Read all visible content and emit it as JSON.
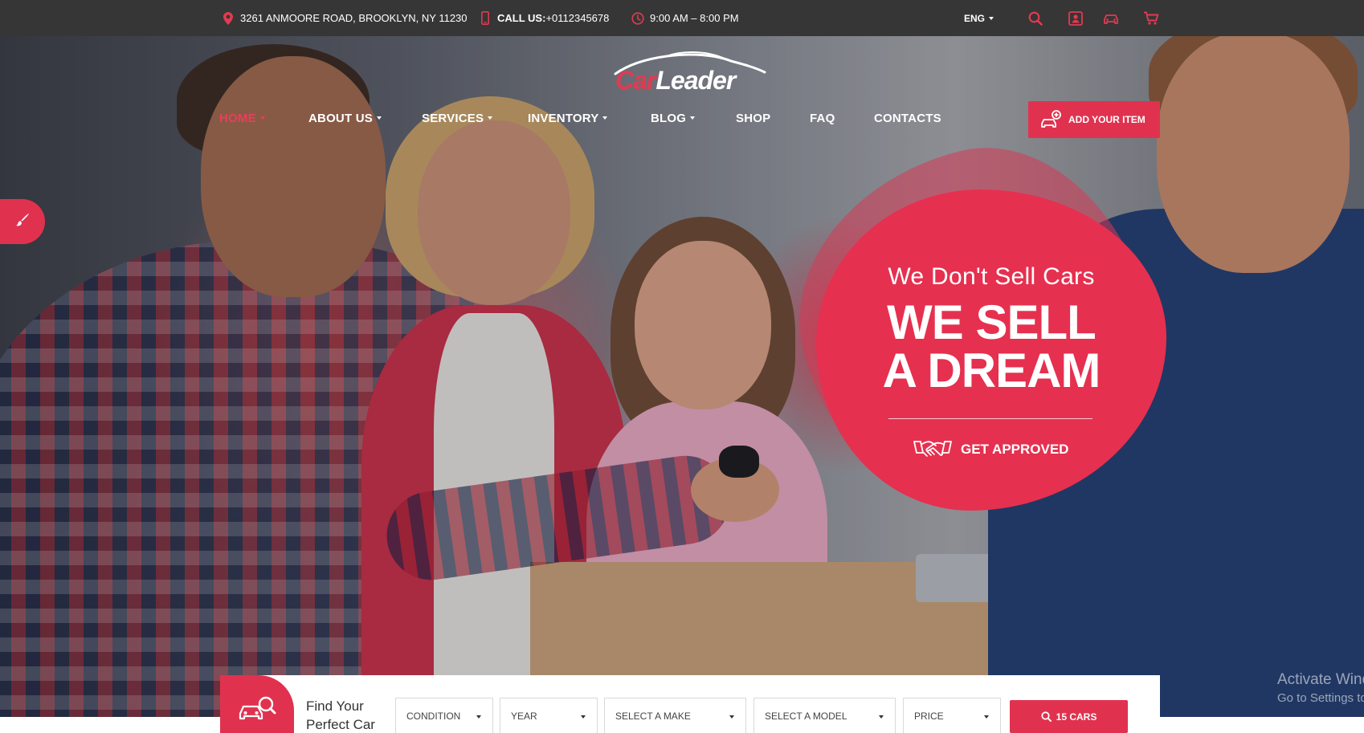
{
  "topbar": {
    "address": "3261 ANMOORE ROAD, BROOKLYN, NY 11230",
    "call_label": "CALL US:",
    "phone": "+0112345678",
    "hours": "9:00 AM – 8:00 PM",
    "language": "ENG",
    "icons": [
      "map-pin-icon",
      "phone-icon",
      "clock-icon",
      "search-icon",
      "user-icon",
      "car-compare-icon",
      "cart-icon"
    ]
  },
  "logo": {
    "part1": "Car",
    "part2": "Leader"
  },
  "nav": {
    "items": [
      {
        "label": "HOME",
        "dropdown": true,
        "active": true
      },
      {
        "label": "ABOUT US",
        "dropdown": true
      },
      {
        "label": "SERVICES",
        "dropdown": true
      },
      {
        "label": "INVENTORY",
        "dropdown": true
      },
      {
        "label": "BLOG",
        "dropdown": true
      },
      {
        "label": "SHOP",
        "dropdown": false
      },
      {
        "label": "FAQ",
        "dropdown": false
      },
      {
        "label": "CONTACTS",
        "dropdown": false
      }
    ],
    "add_item_label": "ADD YOUR ITEM"
  },
  "hero": {
    "subtitle": "We Don't Sell Cars",
    "title_line1": "WE SELL",
    "title_line2": "A DREAM",
    "cta_label": "GET APPROVED"
  },
  "search": {
    "title_line1": "Find Your",
    "title_line2": "Perfect Car",
    "selects": [
      {
        "value": "CONDITION"
      },
      {
        "value": "YEAR"
      },
      {
        "value": "SELECT A MAKE"
      },
      {
        "value": "SELECT A MODEL"
      },
      {
        "value": "PRICE"
      }
    ],
    "button_label": "15 CARS"
  },
  "watermark": {
    "line1": "Activate Windows",
    "line2": "Go to Settings to activate Windows."
  },
  "colors": {
    "accent": "#e0324f",
    "nav_active": "#ea3e5a",
    "topbar_bg": "#363636"
  }
}
